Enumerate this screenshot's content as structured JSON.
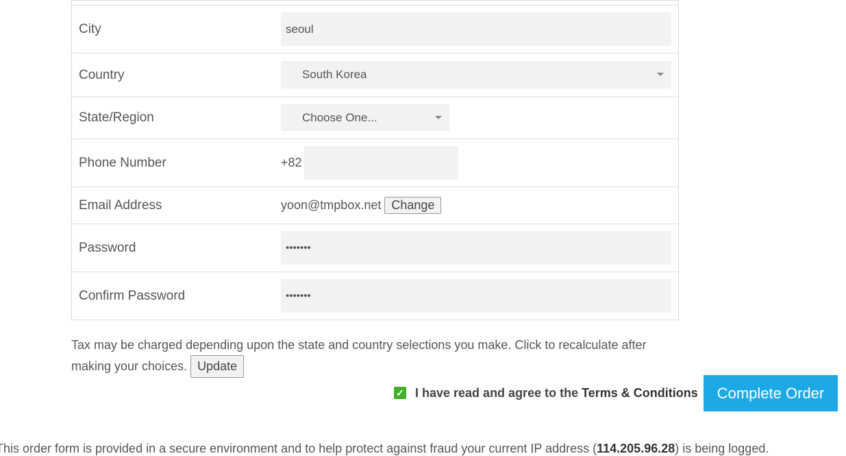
{
  "form": {
    "city": {
      "label": "City",
      "value": "seoul"
    },
    "country": {
      "label": "Country",
      "value": "South Korea"
    },
    "state": {
      "label": "State/Region",
      "value": "Choose One..."
    },
    "phone": {
      "label": "Phone Number",
      "prefix": "+82",
      "value": ""
    },
    "email": {
      "label": "Email Address",
      "value": "yoon@tmpbox.net",
      "change_label": "Change"
    },
    "password": {
      "label": "Password",
      "value": "•••••••"
    },
    "confirm_password": {
      "label": "Confirm Password",
      "value": "•••••••"
    }
  },
  "tax": {
    "text": "Tax may be charged depending upon the state and country selections you make. Click to recalculate after making your choices.",
    "update_label": "Update"
  },
  "agree": {
    "text": "I have read and agree to the",
    "link": "Terms & Conditions",
    "checked": true
  },
  "complete_label": "Complete Order",
  "footer": {
    "text_before": "This order form is provided in a secure environment and to help protect against fraud your current IP address (",
    "ip": "114.205.96.28",
    "text_after": ") is being logged."
  },
  "colors": {
    "accent": "#1ca9e6",
    "checkbox": "#43b02a",
    "field_bg": "#f2f2f2"
  },
  "icons": {
    "dropdown": "caret-down-icon",
    "check": "checkmark-icon"
  }
}
